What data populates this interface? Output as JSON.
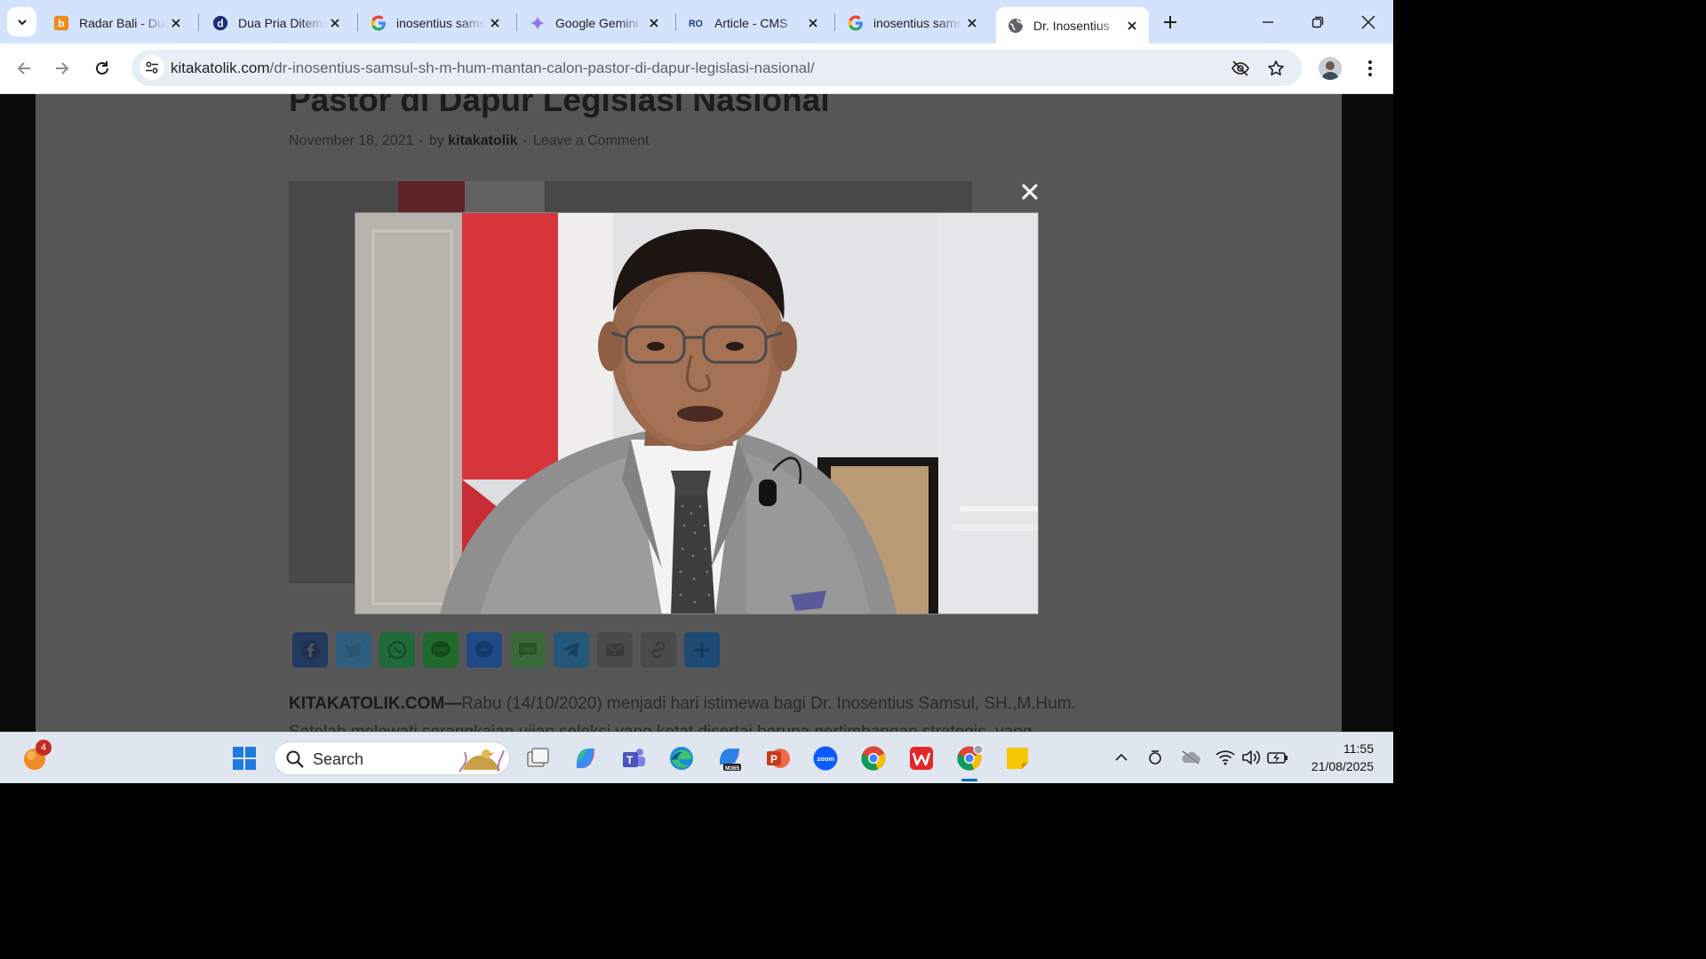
{
  "browser": {
    "tabs": [
      {
        "title": "Radar Bali - Dua",
        "icon": "radar-bali-favicon",
        "active": false
      },
      {
        "title": "Dua Pria Ditemukan",
        "icon": "detik-favicon",
        "active": false
      },
      {
        "title": "inosentius samsul",
        "icon": "google-favicon",
        "active": false
      },
      {
        "title": "Google Gemini",
        "icon": "gemini-favicon",
        "active": false
      },
      {
        "title": "Article - CMS",
        "icon": "cms-favicon",
        "active": false
      },
      {
        "title": "inosentius samsul",
        "icon": "google-favicon",
        "active": false
      },
      {
        "title": "Dr. Inosentius",
        "icon": "globe-favicon",
        "active": true
      }
    ],
    "url": {
      "domain": "kitakatolik.com",
      "path": "/dr-inosentius-samsul-sh-m-hum-mantan-calon-pastor-di-dapur-legislasi-nasional/"
    }
  },
  "article": {
    "title": "Pastor di Dapur Legislasi Nasional",
    "date": "November 18, 2021",
    "by_label": "by",
    "author": "kitakatolik",
    "comment_link": "Leave a Comment",
    "share_buttons": [
      "Facebook",
      "Twitter",
      "WhatsApp",
      "Line",
      "Messenger",
      "SMS",
      "Telegram",
      "Email",
      "Copy Link",
      "Share"
    ],
    "lead_source": "KITAKATOLIK.COM—",
    "lead_text": "Rabu (14/10/2020) menjadi hari istimewa bagi Dr. Inosentius Samsul, SH.,M.Hum.",
    "next_text": "Setelah melewati serangkaian ujian seleksi yang ketat disertai berupa pertimbangan strategis, yang"
  },
  "lightbox": {
    "close_label": "×"
  },
  "taskbar": {
    "notification_count": "4",
    "search_placeholder": "Search",
    "time": "11:55",
    "date": "21/08/2025",
    "apps": [
      "File Explorer",
      "Copilot",
      "Teams",
      "Edge",
      "Microsoft 365",
      "PowerPoint",
      "Zoom",
      "Chrome",
      "WPS Office",
      "Chrome (active)",
      "Sticky Notes"
    ]
  },
  "colors": {
    "tabstrip": "#d3e3fd",
    "facebook": "#3b5998",
    "twitter": "#55acee",
    "whatsapp": "#25d366",
    "line": "#00c300",
    "messenger": "#0084ff",
    "telegram": "#2ca5e0"
  }
}
